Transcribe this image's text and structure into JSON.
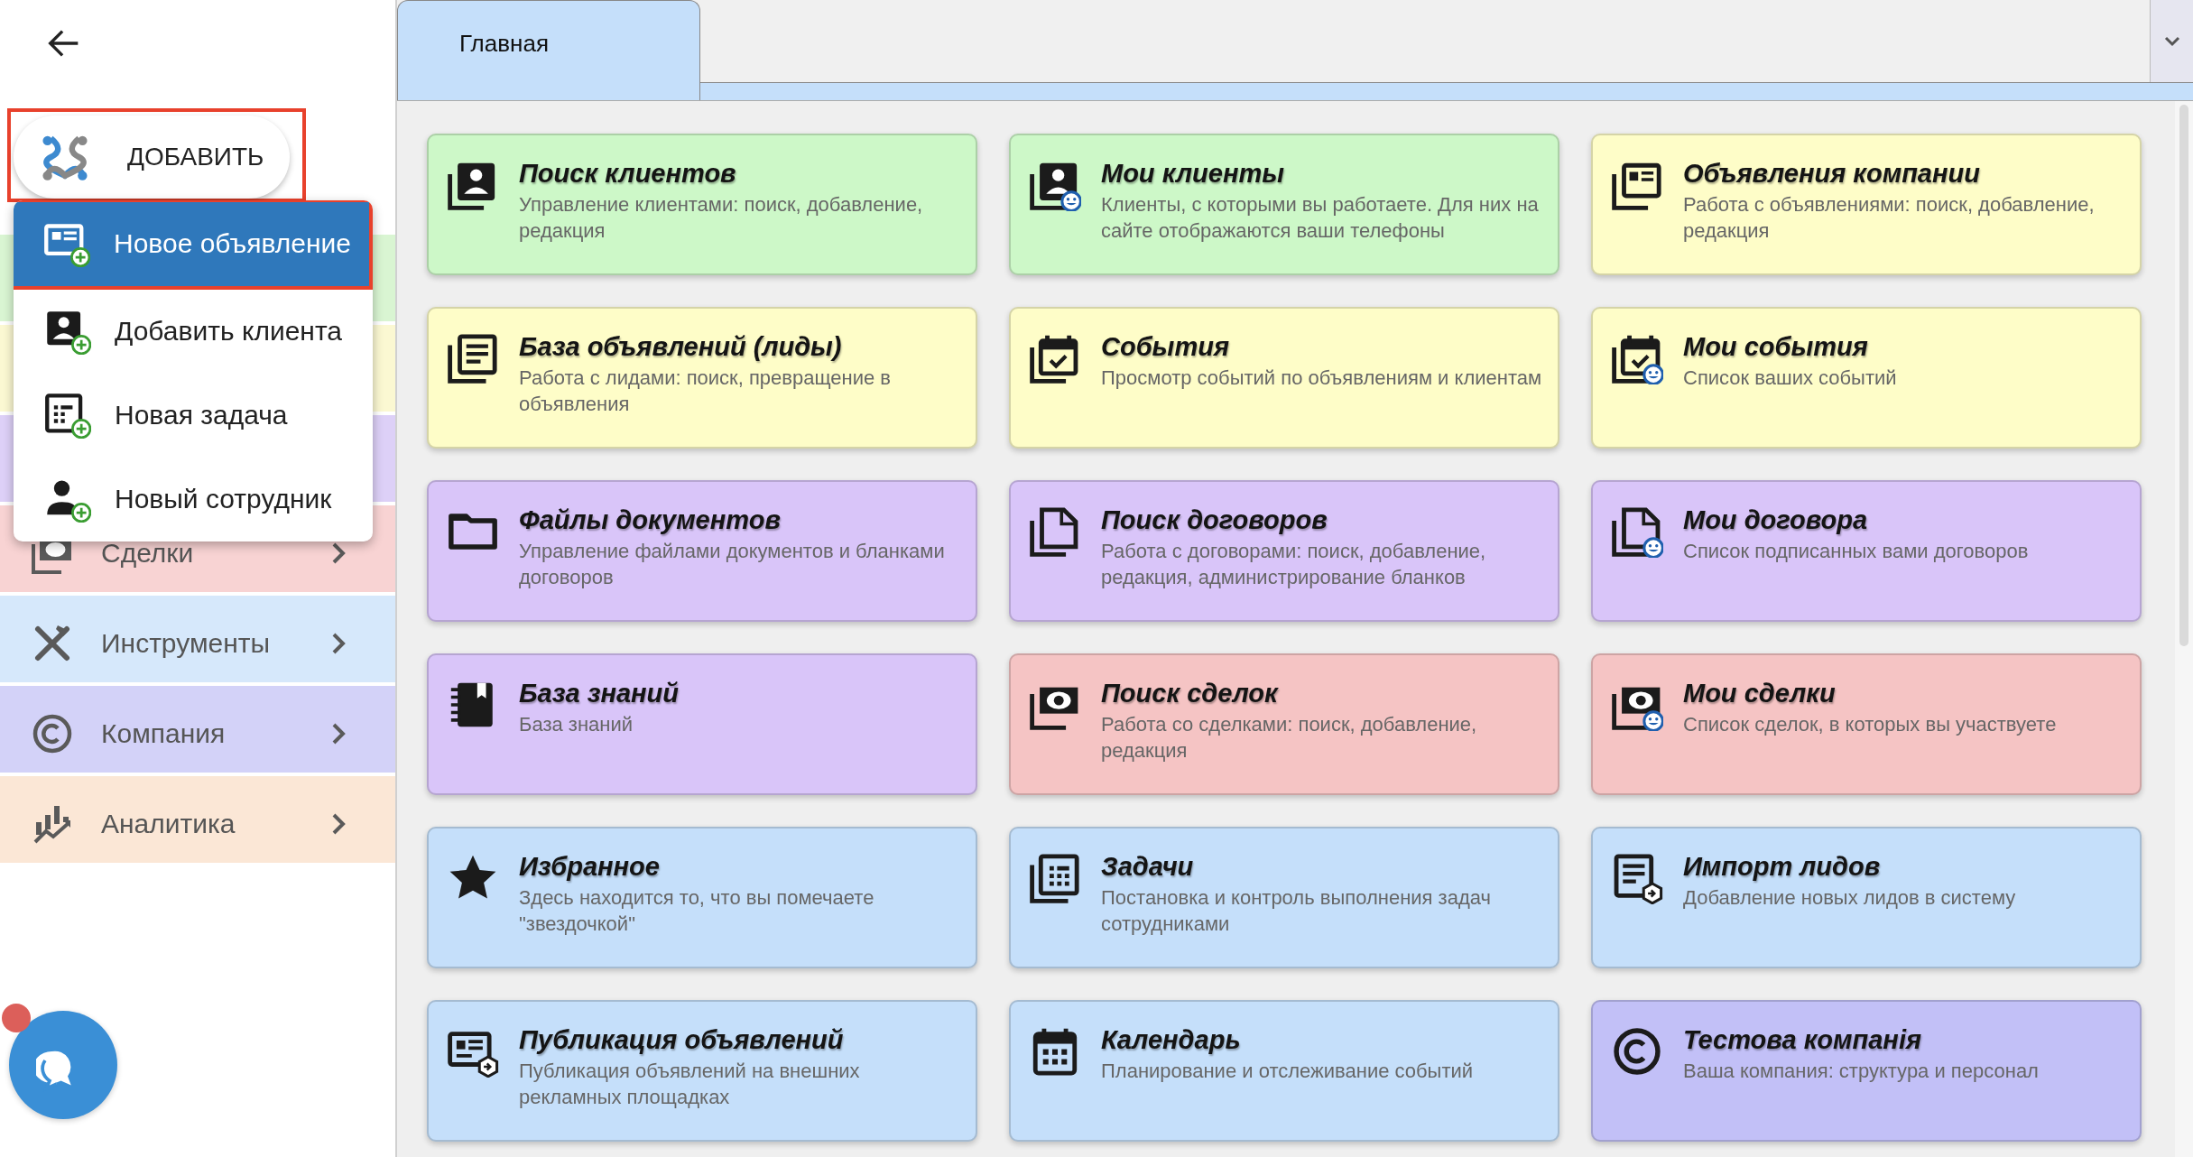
{
  "sidebar": {
    "add_button": {
      "label": "ДОБАВИТЬ",
      "highlighted": true
    },
    "add_menu": [
      {
        "label": "Новое объявление",
        "selected": true,
        "highlighted": true
      },
      {
        "label": "Добавить клиента",
        "selected": false,
        "highlighted": false
      },
      {
        "label": "Новая задача",
        "selected": false,
        "highlighted": false
      },
      {
        "label": "Новый сотрудник",
        "selected": false,
        "highlighted": false
      }
    ],
    "menu": [
      {
        "color": "#d9f5d2"
      },
      {
        "color": "#fbf8d2"
      },
      {
        "color": "#ddd0f7"
      },
      {
        "label": "Сделки",
        "color": "#f8d3d3"
      },
      {
        "label": "Инструменты",
        "color": "#d6e8fb"
      },
      {
        "label": "Компания",
        "color": "#d3d2f8"
      },
      {
        "label": "Аналитика",
        "color": "#fbe7d6"
      }
    ],
    "chat": {
      "unread": true
    }
  },
  "tabs": [
    {
      "label": "Главная",
      "selected": true
    }
  ],
  "tiles": [
    {
      "title": "Поиск клиентов",
      "description": "Управление клиентами: поиск, добавление, редакция",
      "color": "#cdf8c8"
    },
    {
      "title": "Мои клиенты",
      "description": "Клиенты, с которыми вы работаете. Для них на сайте отображаются ваши телефоны",
      "color": "#cdf8c8"
    },
    {
      "title": "Объявления компании",
      "description": "Работа с объявлениями: поиск, добавление, редакция",
      "color": "#fefdc8"
    },
    {
      "title": "База объявлений (лиды)",
      "description": "Работа с лидами: поиск, превращение в объявления",
      "color": "#fefdc8"
    },
    {
      "title": "События",
      "description": "Просмотр событий по объявлениям и клиентам",
      "color": "#fefdc8"
    },
    {
      "title": "Мои события",
      "description": "Список ваших событий",
      "color": "#fefdc8"
    },
    {
      "title": "Файлы документов",
      "description": "Управление файлами документов и бланками договоров",
      "color": "#d9c5f9"
    },
    {
      "title": "Поиск договоров",
      "description": "Работа с договорами: поиск, добавление, редакция, администрирование бланков",
      "color": "#d9c5f9"
    },
    {
      "title": "Мои договора",
      "description": "Список подписанных вами договоров",
      "color": "#d9c5f9"
    },
    {
      "title": "База знаний",
      "description": "База знаний",
      "color": "#d9c5f9"
    },
    {
      "title": "Поиск сделок",
      "description": "Работа со сделками: поиск, добавление, редакция",
      "color": "#f5c4c4"
    },
    {
      "title": "Мои сделки",
      "description": "Список сделок, в которых вы участвуете",
      "color": "#f5c4c4"
    },
    {
      "title": "Избранное",
      "description": "Здесь находится то, что вы помечаете \"звездочкой\"",
      "color": "#c5dffa"
    },
    {
      "title": "Задачи",
      "description": "Постановка и контроль выполнения задач сотрудниками",
      "color": "#c5dffa"
    },
    {
      "title": "Импорт лидов",
      "description": "Добавление новых лидов в систему",
      "color": "#c5dffa"
    },
    {
      "title": "Публикация объявлений",
      "description": "Публикация объявлений на внешних рекламных площадках",
      "color": "#c5dffa"
    },
    {
      "title": "Календарь",
      "description": "Планирование и отслеживание событий",
      "color": "#c5dffa"
    },
    {
      "title": "Тестова компанія",
      "description": "Ваша компания: структура и персонал",
      "color": "#c2c0f7"
    }
  ]
}
